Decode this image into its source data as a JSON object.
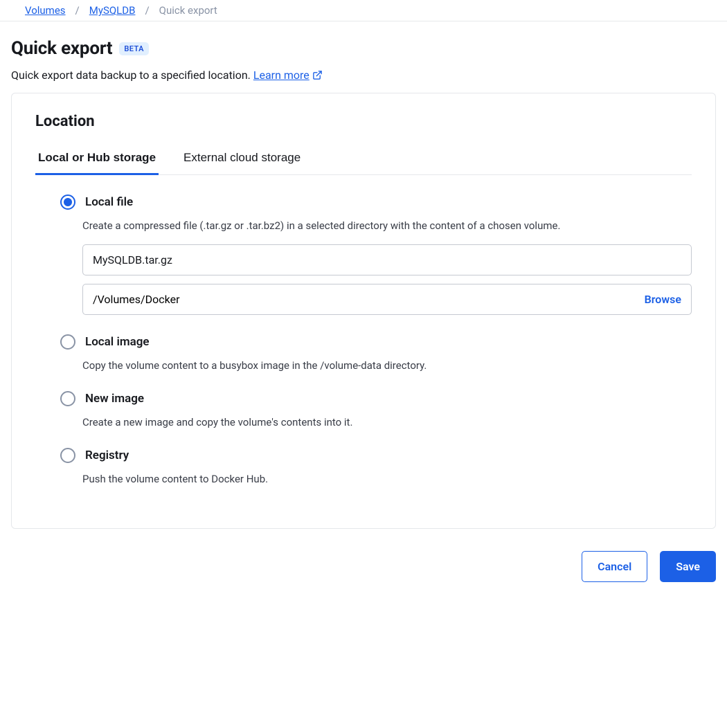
{
  "breadcrumb": {
    "items": [
      {
        "label": "Volumes",
        "link": true
      },
      {
        "label": "MySQLDB",
        "link": true
      },
      {
        "label": "Quick export",
        "link": false
      }
    ]
  },
  "header": {
    "title": "Quick export",
    "badge": "BETA",
    "subtitle": "Quick export data backup to a specified location. ",
    "learn_more": "Learn more"
  },
  "card": {
    "title": "Location",
    "tabs": [
      {
        "label": "Local or Hub storage",
        "active": true
      },
      {
        "label": "External cloud storage",
        "active": false
      }
    ],
    "options": {
      "local_file": {
        "title": "Local file",
        "desc": "Create a compressed file (.tar.gz or .tar.bz2) in a selected directory with the content of a chosen volume.",
        "filename_value": "MySQLDB.tar.gz",
        "path_value": "/Volumes/Docker",
        "browse_label": "Browse"
      },
      "local_image": {
        "title": "Local image",
        "desc": "Copy the volume content to a busybox image in the /volume-data directory."
      },
      "new_image": {
        "title": "New image",
        "desc": "Create a new image and copy the volume's contents into it."
      },
      "registry": {
        "title": "Registry",
        "desc": "Push the volume content to Docker Hub."
      }
    }
  },
  "footer": {
    "cancel": "Cancel",
    "save": "Save"
  }
}
